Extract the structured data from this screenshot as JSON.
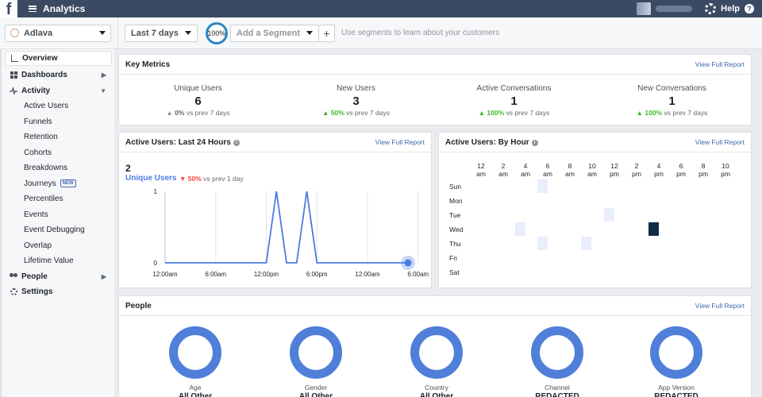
{
  "topbar": {
    "logo_glyph": "f",
    "title": "Analytics",
    "help_label": "Help",
    "help_glyph": "?"
  },
  "toolbar": {
    "app_name": "Adlava",
    "date_range": "Last 7 days",
    "sample_pct": "100%",
    "add_segment": "Add a Segment",
    "plus": "+",
    "segment_hint": "Use segments to learn about your customers"
  },
  "sidebar": {
    "overview": "Overview",
    "dashboards": "Dashboards",
    "activity": "Activity",
    "activity_items": [
      "Active Users",
      "Funnels",
      "Retention",
      "Cohorts",
      "Breakdowns",
      "Journeys",
      "Percentiles",
      "Events",
      "Event Debugging",
      "Overlap",
      "Lifetime Value"
    ],
    "journeys_badge": "NEW",
    "people": "People",
    "settings": "Settings"
  },
  "key_metrics": {
    "title": "Key Metrics",
    "link": "View Full Report",
    "items": [
      {
        "label": "Unique Users",
        "value": "6",
        "change": "0%",
        "suffix": "vs prev 7 days",
        "trend": "neutral"
      },
      {
        "label": "New Users",
        "value": "3",
        "change": "50%",
        "suffix": "vs prev 7 days",
        "trend": "up"
      },
      {
        "label": "Active Conversations",
        "value": "1",
        "change": "100%",
        "suffix": "vs prev 7 days",
        "trend": "up"
      },
      {
        "label": "New Conversations",
        "value": "1",
        "change": "100%",
        "suffix": "vs prev 7 days",
        "trend": "up"
      }
    ]
  },
  "active_24h": {
    "title": "Active Users: Last 24 Hours",
    "link": "View Full Report",
    "count": "2",
    "series_label": "Unique Users",
    "change": "50%",
    "change_suffix": "vs prev 1 day"
  },
  "by_hour": {
    "title": "Active Users: By Hour",
    "link": "View Full Report",
    "hours": [
      "12",
      "2",
      "4",
      "6",
      "8",
      "10",
      "12",
      "2",
      "4",
      "6",
      "8",
      "10"
    ],
    "periods": [
      "am",
      "am",
      "am",
      "am",
      "am",
      "am",
      "pm",
      "pm",
      "pm",
      "pm",
      "pm",
      "pm"
    ],
    "days": [
      "Sun",
      "Mon",
      "Tue",
      "Wed",
      "Thu",
      "Fri",
      "Sat"
    ],
    "cells": [
      {
        "day": 0,
        "hour": 6,
        "level": 0.1
      },
      {
        "day": 2,
        "hour": 12,
        "level": 0.1
      },
      {
        "day": 3,
        "hour": 4,
        "level": 0.1
      },
      {
        "day": 3,
        "hour": 16,
        "level": 1.0
      },
      {
        "day": 4,
        "hour": 6,
        "level": 0.1
      },
      {
        "day": 4,
        "hour": 9,
        "level": 0.1
      }
    ],
    "colors": {
      "low": "#e8eefb",
      "high": "#0e2a47"
    }
  },
  "people": {
    "title": "People",
    "link": "View Full Report",
    "items": [
      {
        "label": "Age",
        "value": "All Other"
      },
      {
        "label": "Gender",
        "value": "All Other"
      },
      {
        "label": "Country",
        "value": "All Other"
      },
      {
        "label": "Channel",
        "value": "REDACTED"
      },
      {
        "label": "App Version",
        "value": "REDACTED"
      }
    ]
  },
  "chart_data": {
    "type": "line",
    "title": "",
    "x_ticks": [
      "12:00am",
      "6:00am",
      "12:00pm",
      "6:00pm",
      "12:00am",
      "6:00am"
    ],
    "y_ticks": [
      "0",
      "1"
    ],
    "ylim": [
      0,
      1
    ],
    "series": [
      {
        "name": "Unique Users",
        "x": [
          0,
          1,
          2,
          3,
          4,
          5,
          6,
          7,
          8,
          9,
          10,
          11,
          12,
          13,
          14,
          15,
          16,
          17,
          18,
          19,
          20,
          21,
          22,
          23,
          24
        ],
        "values": [
          0,
          0,
          0,
          0,
          0,
          0,
          0,
          0,
          0,
          0,
          0,
          1,
          0,
          0,
          1,
          0,
          0,
          0,
          0,
          0,
          0,
          0,
          0,
          0,
          0
        ]
      }
    ],
    "colors": {
      "line": "#4a7ce0",
      "grid": "#e5e5e5"
    }
  }
}
